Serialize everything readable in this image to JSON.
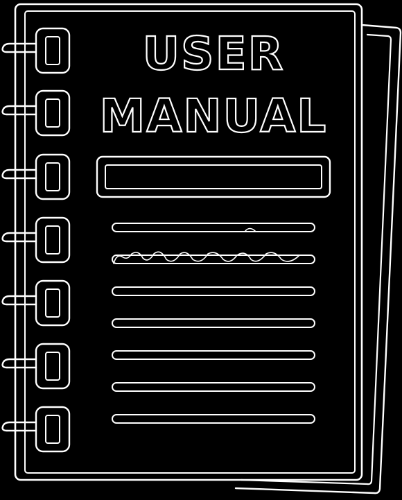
{
  "icon": {
    "name": "user-manual-icon",
    "title_line1": "USER",
    "title_line2": "MANUAL",
    "stroke_color": "#ffffff",
    "background_color": "#000000"
  }
}
